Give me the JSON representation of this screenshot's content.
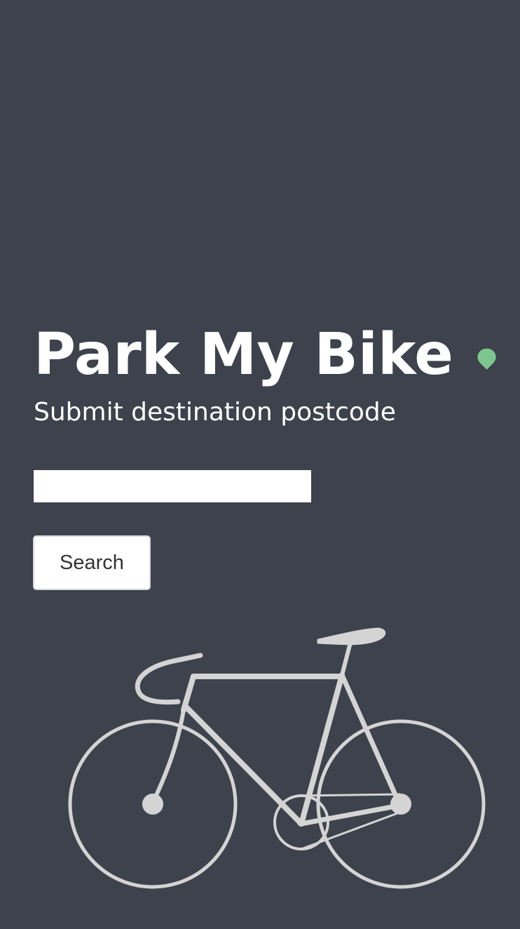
{
  "app": {
    "title": "Park My Bike",
    "subtitle": "Submit destination postcode"
  },
  "search": {
    "postcode_value": "",
    "placeholder": "",
    "button_label": "Search"
  },
  "icons": {
    "pin": "map-pin-icon",
    "bike": "bicycle-illustration"
  },
  "colors": {
    "background": "#3d424c",
    "accent_pin": "#7dc68f",
    "bike_stroke": "#d4d4d4",
    "text": "#ffffff"
  }
}
